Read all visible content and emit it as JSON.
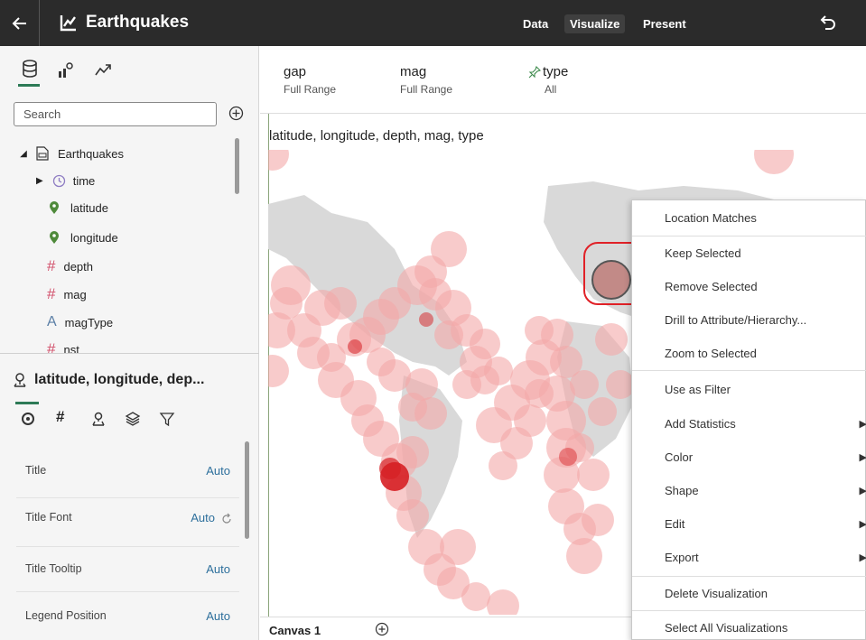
{
  "header": {
    "back_icon": "arrow-left-icon",
    "app_icon": "chart-icon",
    "title": "Earthquakes",
    "tabs": [
      {
        "label": "Data",
        "active": false
      },
      {
        "label": "Visualize",
        "active": true
      },
      {
        "label": "Present",
        "active": false
      }
    ],
    "undo_icon": "undo-icon"
  },
  "data_panel": {
    "tab_icons": [
      "database-icon",
      "visualization-types-icon",
      "analytics-icon"
    ],
    "search_placeholder": "Search",
    "add_icon": "add-circle-icon",
    "tree": [
      {
        "label": "Earthquakes",
        "icon": "dataset-icon",
        "expanded": true
      },
      {
        "label": "time",
        "icon": "clock-icon",
        "expanded": false
      },
      {
        "label": "latitude",
        "icon": "location-pin-icon"
      },
      {
        "label": "longitude",
        "icon": "location-pin-icon"
      },
      {
        "label": "depth",
        "icon": "hash-icon"
      },
      {
        "label": "mag",
        "icon": "hash-icon"
      },
      {
        "label": "magType",
        "icon": "text-icon"
      },
      {
        "label": "nst",
        "icon": "hash-icon"
      }
    ]
  },
  "properties_panel": {
    "viz_title": "latitude, longitude, dep...",
    "viz_icon": "map-viz-icon",
    "tab_icons": [
      "general-icon",
      "values-icon",
      "map-icon",
      "layers-icon",
      "filter-icon"
    ],
    "rows": [
      {
        "label": "Title",
        "value": "Auto"
      },
      {
        "label": "Title Font",
        "value": "Auto"
      },
      {
        "label": "Title Tooltip",
        "value": "Auto"
      },
      {
        "label": "Legend Position",
        "value": "Auto"
      }
    ]
  },
  "filters": [
    {
      "name": "gap",
      "value": "Full Range",
      "pinned": false
    },
    {
      "name": "mag",
      "value": "Full Range",
      "pinned": false
    },
    {
      "name": "type",
      "value": "All",
      "pinned": true
    }
  ],
  "visualization": {
    "title": "latitude, longitude, depth, mag, type",
    "accent": "#e02127",
    "bubble_color": "#f4a9a8"
  },
  "canvas_tabs": {
    "active": "Canvas 1",
    "add_icon": "add-circle-icon"
  },
  "context_menu": {
    "items": [
      {
        "label": "Location Matches",
        "submenu": false
      },
      {
        "label": "Keep Selected",
        "submenu": false
      },
      {
        "label": "Remove Selected",
        "submenu": false
      },
      {
        "label": "Drill to Attribute/Hierarchy...",
        "submenu": false
      },
      {
        "label": "Zoom to Selected",
        "submenu": false
      },
      {
        "label": "Use as Filter",
        "submenu": false,
        "highlighted": true
      },
      {
        "label": "Add Statistics",
        "submenu": true
      },
      {
        "label": "Color",
        "submenu": true
      },
      {
        "label": "Shape",
        "submenu": true
      },
      {
        "label": "Edit",
        "submenu": true
      },
      {
        "label": "Export",
        "submenu": true
      },
      {
        "label": "Delete Visualization",
        "submenu": false
      },
      {
        "label": "Select All Visualizations",
        "submenu": false
      }
    ]
  }
}
